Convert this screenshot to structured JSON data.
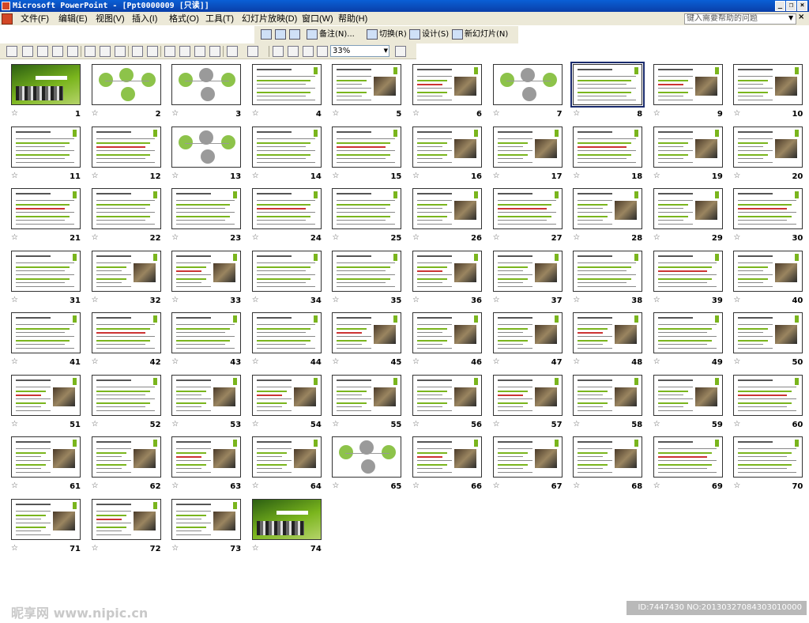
{
  "window": {
    "title": "Microsoft PowerPoint - [Ppt0000009 [只读]]",
    "buttons": [
      "_",
      "❐",
      "×"
    ]
  },
  "menu": {
    "items": [
      "文件(F)",
      "编辑(E)",
      "视图(V)",
      "插入(I)",
      "格式(O)",
      "工具(T)",
      "幻灯片放映(D)",
      "窗口(W)",
      "帮助(H)"
    ],
    "help_placeholder": "键入需要帮助的问题"
  },
  "toolbar1": {
    "notes_label": "备注(N)...",
    "transition_label": "切换(R)",
    "design_label": "设计(S)",
    "new_slide_label": "新幻灯片(N)"
  },
  "toolbar2": {
    "zoom": "33%"
  },
  "slides": {
    "selected": 8,
    "numbers": [
      "1",
      "2",
      "3",
      "4",
      "5",
      "6",
      "7",
      "8",
      "9",
      "10",
      "11",
      "12",
      "13",
      "14",
      "15",
      "16",
      "17",
      "18",
      "19",
      "20",
      "21",
      "22",
      "23",
      "24",
      "25",
      "26",
      "27",
      "28",
      "29",
      "30",
      "31",
      "32",
      "33",
      "34",
      "35",
      "36",
      "37",
      "38",
      "39",
      "40",
      "41",
      "42",
      "43",
      "44",
      "45",
      "46",
      "47",
      "48",
      "49",
      "50",
      "51",
      "52",
      "53",
      "54",
      "55",
      "56",
      "57",
      "58",
      "59",
      "60",
      "61",
      "62",
      "63",
      "64",
      "65",
      "66",
      "67",
      "68",
      "69",
      "70",
      "71",
      "72",
      "73",
      "74"
    ]
  },
  "watermark": "昵享网 www.nipic.cn",
  "image_id": "ID:7447430 NO:20130327084303010000",
  "colors": {
    "accent_green": "#7ab51d",
    "titlebar_blue": "#0a3fa8",
    "selection": "#1a2b6d"
  }
}
